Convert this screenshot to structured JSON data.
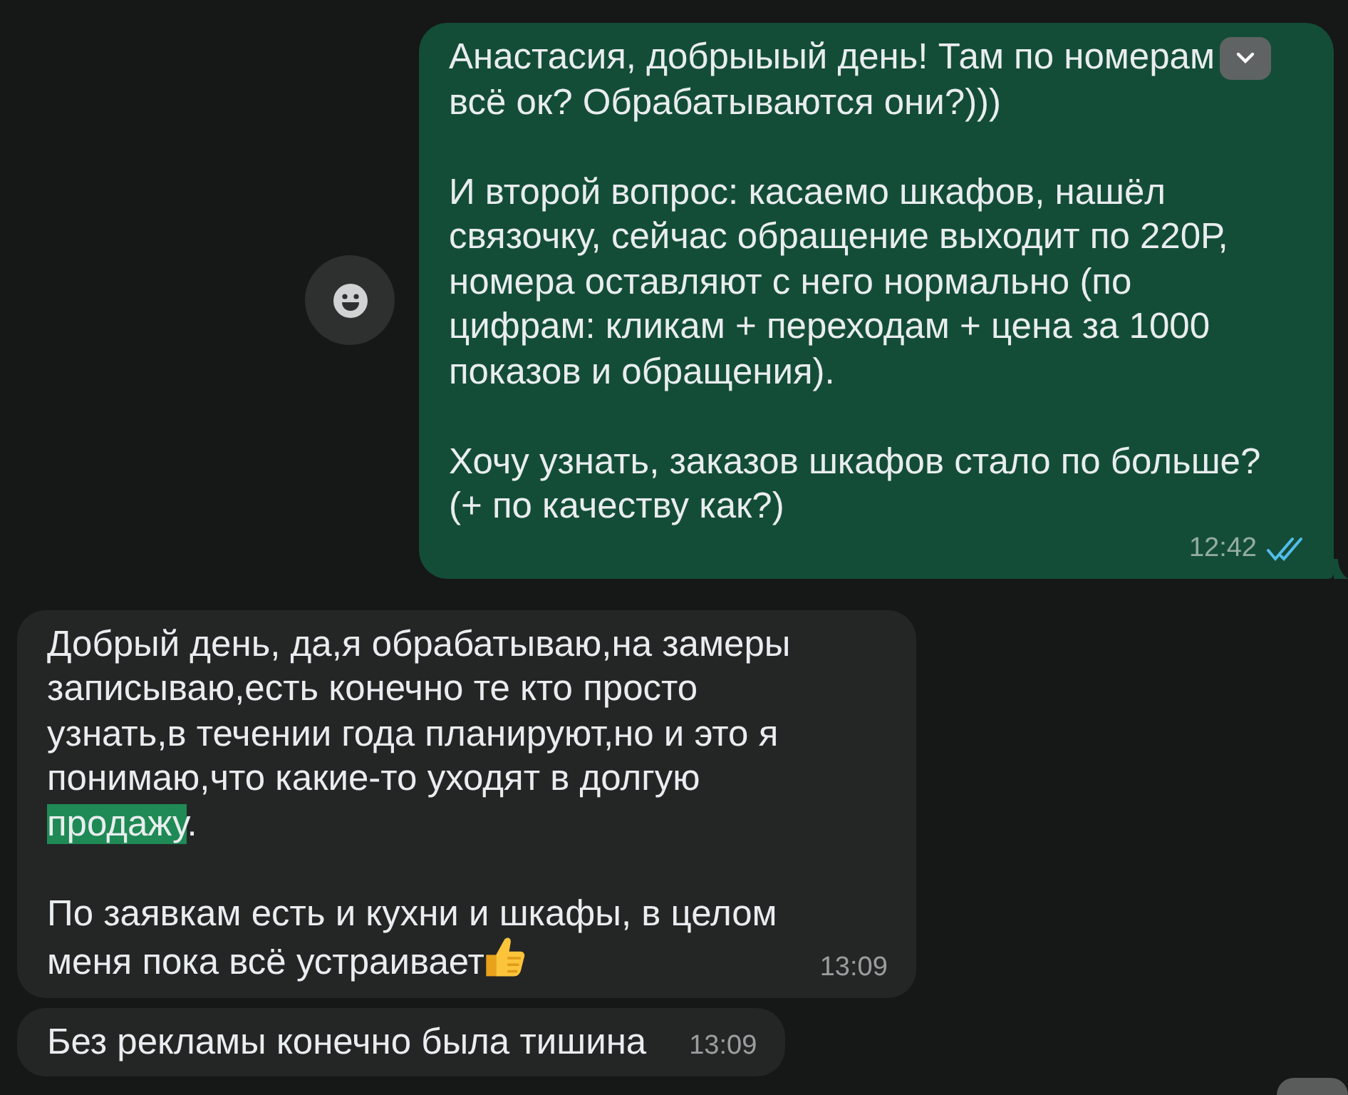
{
  "messages": [
    {
      "kind": "outgoing",
      "react_button": true,
      "menu_button": true,
      "paragraphs": [
        [
          {
            "text": "Анастасия, добрыыый день! Там по номерам\nвсё ок? Обрабатываются они?)))",
            "highlighted": false
          }
        ],
        [
          {
            "text": "И второй вопрос: касаемо шкафов, нашёл\nсвязочку, сейчас обращение выходит по 220Р,\nномера оставляют с него нормально (по\nцифрам: кликам + переходам + цена за 1000\nпоказов и обращения).",
            "highlighted": false
          }
        ],
        [
          {
            "text": "Хочу узнать, заказов шкафов стало по больше?\n(+ по качеству как?)",
            "highlighted": false
          }
        ]
      ],
      "time": "12:42",
      "read": true
    },
    {
      "kind": "incoming",
      "paragraphs": [
        [
          {
            "text": "Добрый день, да,я обрабатываю,на замеры\nзаписываю,есть конечно те кто просто\nузнать,в течении года планируют,но и это я\nпонимаю,что какие-то уходят в долгую\n",
            "highlighted": false
          },
          {
            "text": "продажу",
            "highlighted": true
          },
          {
            "text": ".",
            "highlighted": false
          }
        ],
        [
          {
            "text": "По заявкам есть и кухни и шкафы, в целом\nменя пока всё устраивает",
            "highlighted": false
          }
        ]
      ],
      "thumbs_up": true,
      "time": "13:09"
    },
    {
      "kind": "incoming",
      "paragraphs": [
        [
          {
            "text": "Без рекламы конечно была тишина",
            "highlighted": false
          }
        ]
      ],
      "time": "13:09"
    }
  ],
  "scroll_down_button": true
}
